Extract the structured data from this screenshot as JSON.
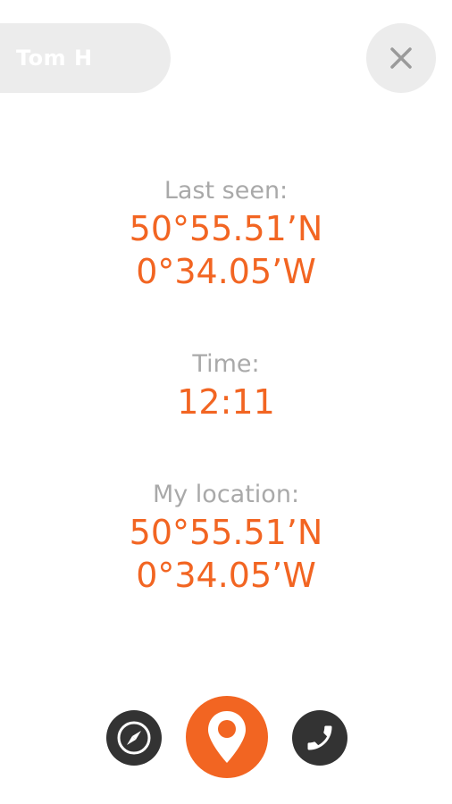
{
  "header": {
    "contact_name": "Tom H",
    "close_icon": "close-icon"
  },
  "last_seen": {
    "label": "Last seen:",
    "latitude": "50°55.51’N",
    "longitude": "0°34.05’W"
  },
  "time": {
    "label": "Time:",
    "value": "12:11"
  },
  "my_location": {
    "label": "My location:",
    "latitude": "50°55.51’N",
    "longitude": "0°34.05’W"
  },
  "actions": {
    "compass_icon": "compass-icon",
    "location_icon": "location-pin-icon",
    "phone_icon": "phone-icon"
  },
  "colors": {
    "accent": "#f26522",
    "label_gray": "#a9a9a9",
    "button_dark": "#333333",
    "pill_gray": "#ececec"
  }
}
